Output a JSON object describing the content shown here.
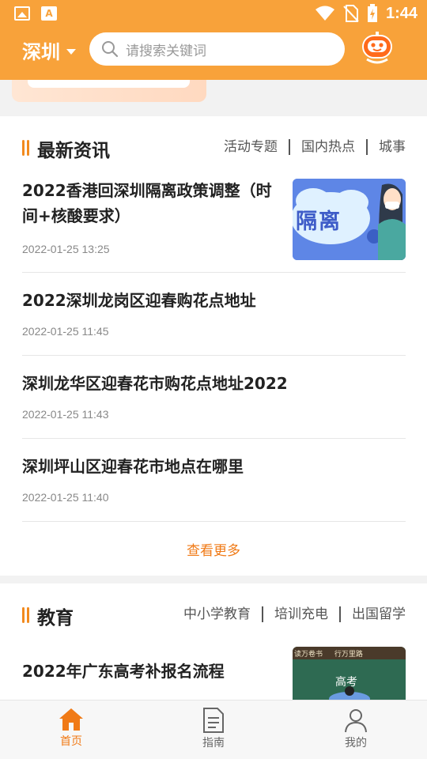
{
  "status_bar": {
    "time": "1:44",
    "icons": [
      "image-icon",
      "font-a-icon",
      "wifi-icon",
      "no-sim-icon",
      "battery-charging-icon"
    ]
  },
  "header": {
    "city": "深圳",
    "search_placeholder": "请搜索关键词",
    "assistant_icon": "robot-face-icon"
  },
  "colors": {
    "brand": "#f8a23a",
    "accent": "#f07a16",
    "bg": "#f2f2f2"
  },
  "news": {
    "title": "最新资讯",
    "tabs": [
      "活动专题",
      "国内热点",
      "城事"
    ],
    "articles": [
      {
        "title": "2022香港回深圳隔离政策调整（时间+核酸要求）",
        "date": "2022-01-25 13:25",
        "thumb_text": "隔离"
      },
      {
        "title": "2022深圳龙岗区迎春购花点地址",
        "date": "2022-01-25 11:45"
      },
      {
        "title": "深圳龙华区迎春花市购花点地址2022",
        "date": "2022-01-25 11:43"
      },
      {
        "title": "深圳坪山区迎春花市地点在哪里",
        "date": "2022-01-25 11:40"
      }
    ],
    "more_label": "查看更多"
  },
  "education": {
    "title": "教育",
    "tabs": [
      "中小学教育",
      "培训充电",
      "出国留学"
    ],
    "articles": [
      {
        "title": "2022年广东高考补报名流程",
        "thumb_text": "高考",
        "thumb_banner": "读万卷书 行万里路"
      }
    ]
  },
  "tabbar": [
    {
      "label": "首页",
      "icon": "home-icon",
      "active": true
    },
    {
      "label": "指南",
      "icon": "document-icon",
      "active": false
    },
    {
      "label": "我的",
      "icon": "user-icon",
      "active": false
    }
  ]
}
